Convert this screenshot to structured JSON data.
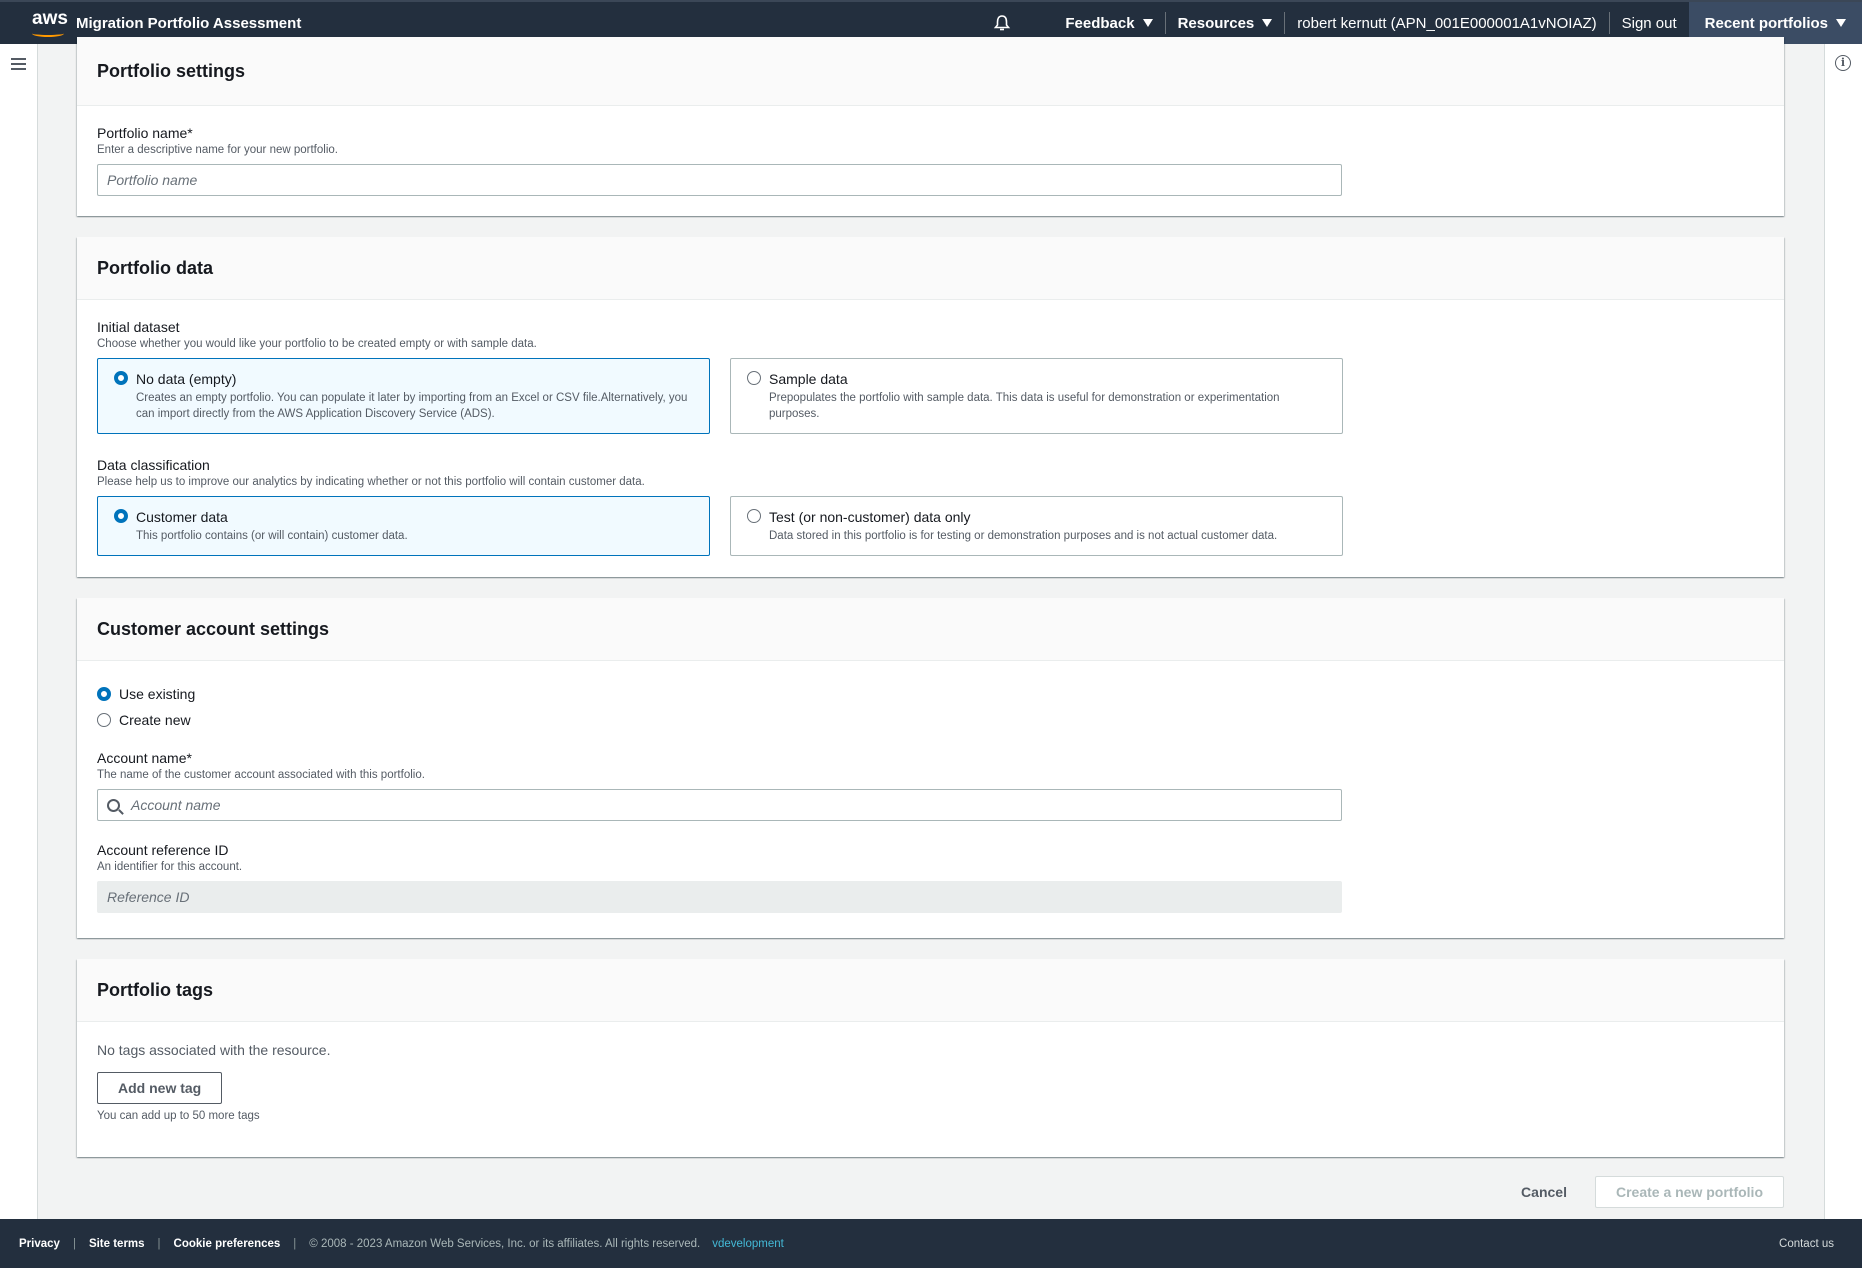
{
  "topnav": {
    "logo_text": "aws",
    "app_title": "Migration Portfolio Assessment",
    "feedback": "Feedback",
    "resources": "Resources",
    "user": "robert kernutt (APN_001E000001A1vNOIAZ)",
    "sign_out": "Sign out",
    "recent_portfolios": "Recent portfolios"
  },
  "settings": {
    "title": "Portfolio settings",
    "name_label": "Portfolio name*",
    "name_desc": "Enter a descriptive name for your new portfolio.",
    "name_placeholder": "Portfolio name"
  },
  "data": {
    "title": "Portfolio data",
    "initial_label": "Initial dataset",
    "initial_desc": "Choose whether you would like your portfolio to be created empty or with sample data.",
    "tiles": [
      {
        "title": "No data (empty)",
        "desc": "Creates an empty portfolio. You can populate it later by importing from an Excel or CSV file.Alternatively, you can import directly from the AWS Application Discovery Service (ADS).",
        "selected": true
      },
      {
        "title": "Sample data",
        "desc": "Prepopulates the portfolio with sample data. This data is useful for demonstration or experimentation purposes.",
        "selected": false
      }
    ],
    "class_label": "Data classification",
    "class_desc": "Please help us to improve our analytics by indicating whether or not this portfolio will contain customer data.",
    "class_tiles": [
      {
        "title": "Customer data",
        "desc": "This portfolio contains (or will contain) customer data.",
        "selected": true
      },
      {
        "title": "Test (or non-customer) data only",
        "desc": "Data stored in this portfolio is for testing or demonstration purposes and is not actual customer data.",
        "selected": false
      }
    ]
  },
  "account": {
    "title": "Customer account settings",
    "options": [
      "Use existing",
      "Create new"
    ],
    "selected": "Use existing",
    "name_label": "Account name*",
    "name_desc": "The name of the customer account associated with this portfolio.",
    "name_placeholder": "Account name",
    "ref_label": "Account reference ID",
    "ref_desc": "An identifier for this account.",
    "ref_placeholder": "Reference ID"
  },
  "tags": {
    "title": "Portfolio tags",
    "empty": "No tags associated with the resource.",
    "add_button": "Add new tag",
    "limit": "You can add up to 50 more tags"
  },
  "actions": {
    "cancel": "Cancel",
    "create": "Create a new portfolio"
  },
  "footer": {
    "privacy": "Privacy",
    "site_terms": "Site terms",
    "cookie": "Cookie preferences",
    "copyright": "© 2008 - 2023 Amazon Web Services, Inc. or its affiliates. All rights reserved.",
    "env": "vdevelopment",
    "contact": "Contact us"
  },
  "colors": {
    "nav_bg": "#232f3e",
    "accent": "#0073bb",
    "selected_tile_bg": "#f1faff",
    "smile": "#ff9900"
  }
}
